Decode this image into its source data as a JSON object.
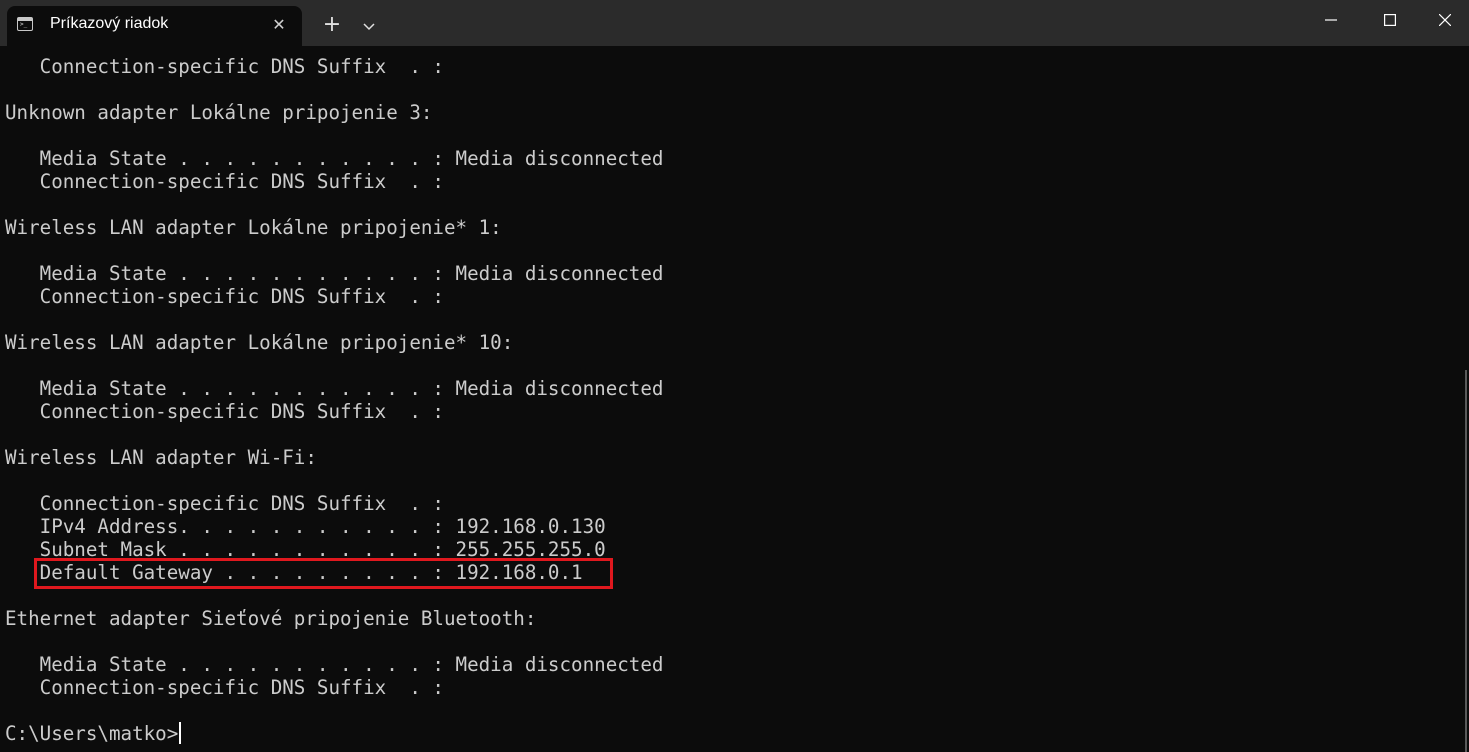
{
  "window": {
    "tab_title": "Príkazový riadok",
    "tab_icon": "terminal-icon",
    "close_tab_icon": "✕",
    "new_tab_icon": "+",
    "dropdown_icon": "chevron-down-icon"
  },
  "terminal": {
    "lines": [
      "   Connection-specific DNS Suffix  . :",
      "",
      "Unknown adapter Lokálne pripojenie 3:",
      "",
      "   Media State . . . . . . . . . . . : Media disconnected",
      "   Connection-specific DNS Suffix  . :",
      "",
      "Wireless LAN adapter Lokálne pripojenie* 1:",
      "",
      "   Media State . . . . . . . . . . . : Media disconnected",
      "   Connection-specific DNS Suffix  . :",
      "",
      "Wireless LAN adapter Lokálne pripojenie* 10:",
      "",
      "   Media State . . . . . . . . . . . : Media disconnected",
      "   Connection-specific DNS Suffix  . :",
      "",
      "Wireless LAN adapter Wi-Fi:",
      "",
      "   Connection-specific DNS Suffix  . :",
      "   IPv4 Address. . . . . . . . . . . : 192.168.0.130",
      "   Subnet Mask . . . . . . . . . . . : 255.255.255.0",
      "   Default Gateway . . . . . . . . . : 192.168.0.1",
      "",
      "Ethernet adapter Sieťové pripojenie Bluetooth:",
      "",
      "   Media State . . . . . . . . . . . : Media disconnected",
      "   Connection-specific DNS Suffix  . :",
      ""
    ],
    "prompt": "C:\\Users\\matko>"
  },
  "colors": {
    "background": "#0c0c0c",
    "titlebar": "#2b2b2b",
    "text": "#cccccc",
    "highlight_border": "#e0181e"
  }
}
